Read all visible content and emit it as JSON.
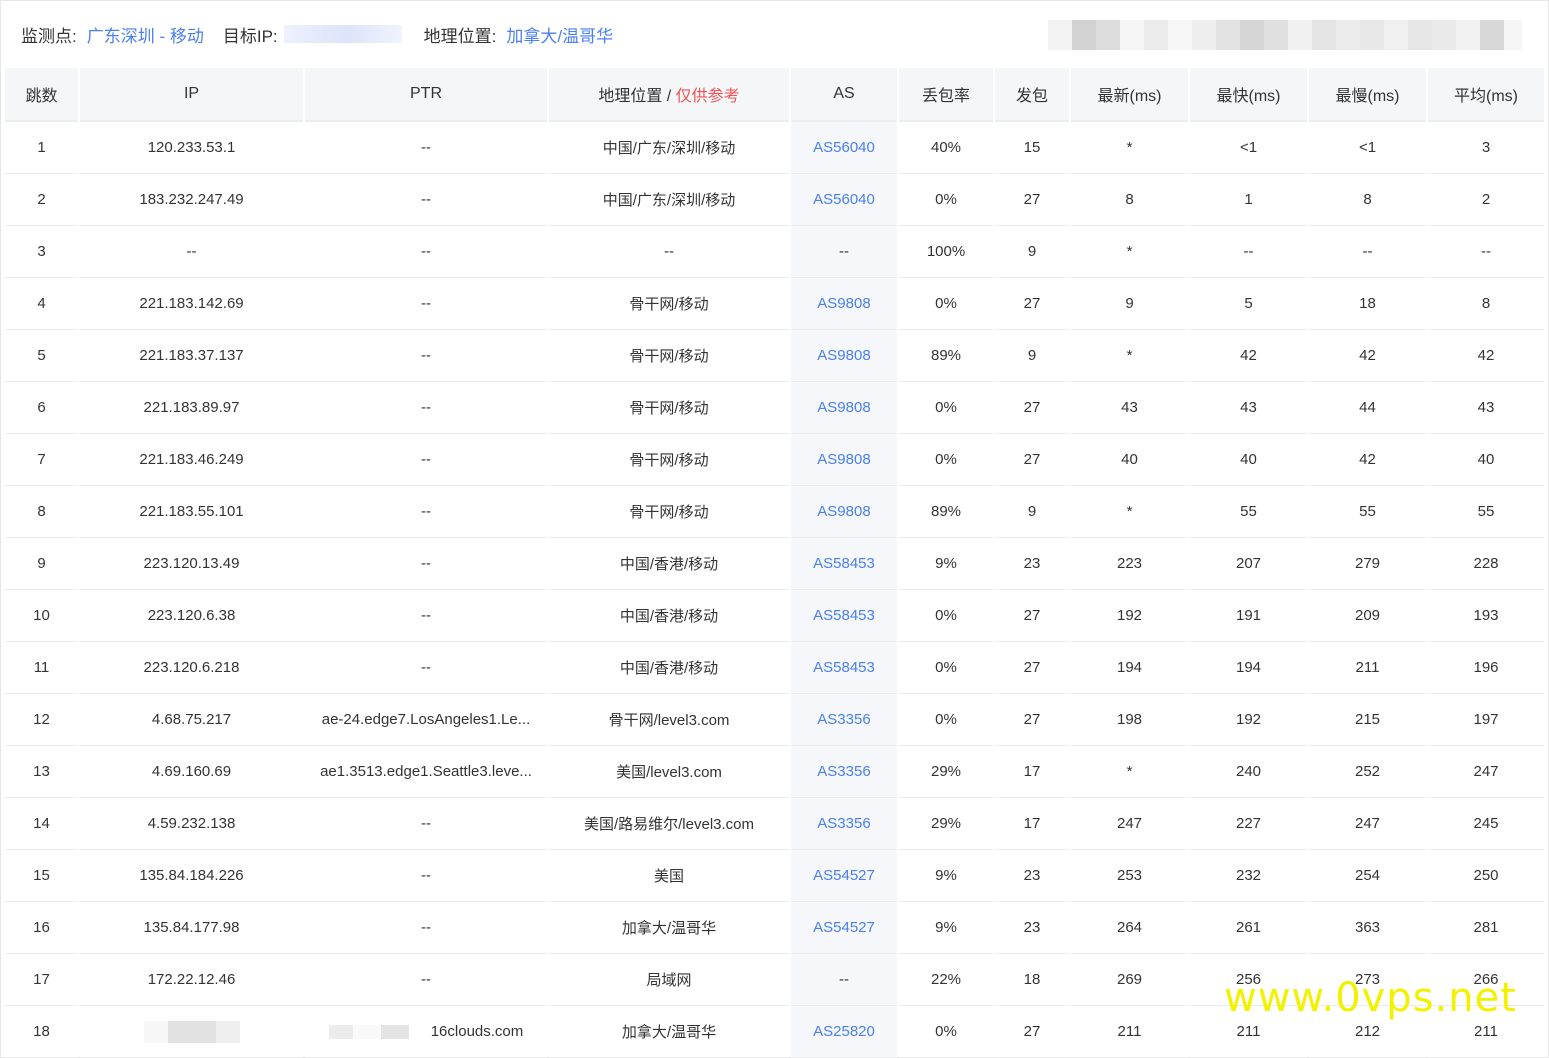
{
  "header": {
    "monitor_label": "监测点:",
    "monitor_value": "广东深圳 - 移动",
    "target_label": "目标IP:",
    "geo_label": "地理位置:",
    "geo_value": "加拿大/温哥华"
  },
  "table": {
    "columns": [
      "跳数",
      "IP",
      "PTR",
      "地理位置 / ",
      "AS",
      "丢包率",
      "发包",
      "最新(ms)",
      "最快(ms)",
      "最慢(ms)",
      "平均(ms)"
    ],
    "geo_ref_note": "仅供参考",
    "rows": [
      {
        "hop": "1",
        "ip": "120.233.53.1",
        "ptr": "--",
        "geo": "中国/广东/深圳/移动",
        "as": "AS56040",
        "loss": "40%",
        "sent": "15",
        "last": "*",
        "best": "<1",
        "worst": "<1",
        "avg": "3"
      },
      {
        "hop": "2",
        "ip": "183.232.247.49",
        "ptr": "--",
        "geo": "中国/广东/深圳/移动",
        "as": "AS56040",
        "loss": "0%",
        "sent": "27",
        "last": "8",
        "best": "1",
        "worst": "8",
        "avg": "2"
      },
      {
        "hop": "3",
        "ip": "--",
        "ptr": "--",
        "geo": "--",
        "as": "--",
        "loss": "100%",
        "sent": "9",
        "last": "*",
        "best": "--",
        "worst": "--",
        "avg": "--"
      },
      {
        "hop": "4",
        "ip": "221.183.142.69",
        "ptr": "--",
        "geo": "骨干网/移动",
        "as": "AS9808",
        "loss": "0%",
        "sent": "27",
        "last": "9",
        "best": "5",
        "worst": "18",
        "avg": "8"
      },
      {
        "hop": "5",
        "ip": "221.183.37.137",
        "ptr": "--",
        "geo": "骨干网/移动",
        "as": "AS9808",
        "loss": "89%",
        "sent": "9",
        "last": "*",
        "best": "42",
        "worst": "42",
        "avg": "42"
      },
      {
        "hop": "6",
        "ip": "221.183.89.97",
        "ptr": "--",
        "geo": "骨干网/移动",
        "as": "AS9808",
        "loss": "0%",
        "sent": "27",
        "last": "43",
        "best": "43",
        "worst": "44",
        "avg": "43"
      },
      {
        "hop": "7",
        "ip": "221.183.46.249",
        "ptr": "--",
        "geo": "骨干网/移动",
        "as": "AS9808",
        "loss": "0%",
        "sent": "27",
        "last": "40",
        "best": "40",
        "worst": "42",
        "avg": "40"
      },
      {
        "hop": "8",
        "ip": "221.183.55.101",
        "ptr": "--",
        "geo": "骨干网/移动",
        "as": "AS9808",
        "loss": "89%",
        "sent": "9",
        "last": "*",
        "best": "55",
        "worst": "55",
        "avg": "55"
      },
      {
        "hop": "9",
        "ip": "223.120.13.49",
        "ptr": "--",
        "geo": "中国/香港/移动",
        "as": "AS58453",
        "loss": "9%",
        "sent": "23",
        "last": "223",
        "best": "207",
        "worst": "279",
        "avg": "228"
      },
      {
        "hop": "10",
        "ip": "223.120.6.38",
        "ptr": "--",
        "geo": "中国/香港/移动",
        "as": "AS58453",
        "loss": "0%",
        "sent": "27",
        "last": "192",
        "best": "191",
        "worst": "209",
        "avg": "193"
      },
      {
        "hop": "11",
        "ip": "223.120.6.218",
        "ptr": "--",
        "geo": "中国/香港/移动",
        "as": "AS58453",
        "loss": "0%",
        "sent": "27",
        "last": "194",
        "best": "194",
        "worst": "211",
        "avg": "196"
      },
      {
        "hop": "12",
        "ip": "4.68.75.217",
        "ptr": "ae-24.edge7.LosAngeles1.Le...",
        "geo": "骨干网/level3.com",
        "as": "AS3356",
        "loss": "0%",
        "sent": "27",
        "last": "198",
        "best": "192",
        "worst": "215",
        "avg": "197"
      },
      {
        "hop": "13",
        "ip": "4.69.160.69",
        "ptr": "ae1.3513.edge1.Seattle3.leve...",
        "geo": "美国/level3.com",
        "as": "AS3356",
        "loss": "29%",
        "sent": "17",
        "last": "*",
        "best": "240",
        "worst": "252",
        "avg": "247"
      },
      {
        "hop": "14",
        "ip": "4.59.232.138",
        "ptr": "--",
        "geo": "美国/路易维尔/level3.com",
        "as": "AS3356",
        "loss": "29%",
        "sent": "17",
        "last": "247",
        "best": "227",
        "worst": "247",
        "avg": "245"
      },
      {
        "hop": "15",
        "ip": "135.84.184.226",
        "ptr": "--",
        "geo": "美国",
        "as": "AS54527",
        "loss": "9%",
        "sent": "23",
        "last": "253",
        "best": "232",
        "worst": "254",
        "avg": "250"
      },
      {
        "hop": "16",
        "ip": "135.84.177.98",
        "ptr": "--",
        "geo": "加拿大/温哥华",
        "as": "AS54527",
        "loss": "9%",
        "sent": "23",
        "last": "264",
        "best": "261",
        "worst": "363",
        "avg": "281"
      },
      {
        "hop": "17",
        "ip": "172.22.12.46",
        "ptr": "--",
        "geo": "局域网",
        "as": "--",
        "loss": "22%",
        "sent": "18",
        "last": "269",
        "best": "256",
        "worst": "273",
        "avg": "266"
      },
      {
        "hop": "18",
        "ip": "",
        "ptr": "16clouds.com",
        "geo": "加拿大/温哥华",
        "as": "AS25820",
        "loss": "0%",
        "sent": "27",
        "last": "211",
        "best": "211",
        "worst": "212",
        "avg": "211"
      }
    ]
  },
  "watermark": "www.0vps.net"
}
